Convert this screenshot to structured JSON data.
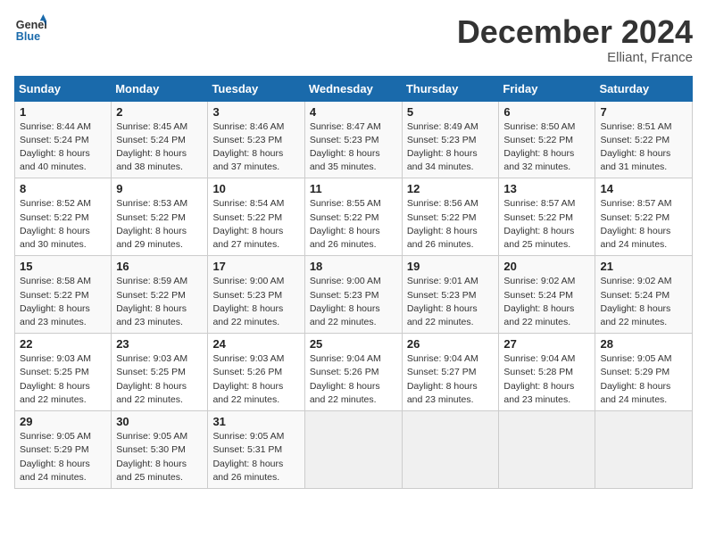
{
  "logo": {
    "line1": "General",
    "line2": "Blue"
  },
  "title": "December 2024",
  "location": "Elliant, France",
  "days_of_week": [
    "Sunday",
    "Monday",
    "Tuesday",
    "Wednesday",
    "Thursday",
    "Friday",
    "Saturday"
  ],
  "weeks": [
    [
      {
        "day": "1",
        "info": "Sunrise: 8:44 AM\nSunset: 5:24 PM\nDaylight: 8 hours and 40 minutes."
      },
      {
        "day": "2",
        "info": "Sunrise: 8:45 AM\nSunset: 5:24 PM\nDaylight: 8 hours and 38 minutes."
      },
      {
        "day": "3",
        "info": "Sunrise: 8:46 AM\nSunset: 5:23 PM\nDaylight: 8 hours and 37 minutes."
      },
      {
        "day": "4",
        "info": "Sunrise: 8:47 AM\nSunset: 5:23 PM\nDaylight: 8 hours and 35 minutes."
      },
      {
        "day": "5",
        "info": "Sunrise: 8:49 AM\nSunset: 5:23 PM\nDaylight: 8 hours and 34 minutes."
      },
      {
        "day": "6",
        "info": "Sunrise: 8:50 AM\nSunset: 5:22 PM\nDaylight: 8 hours and 32 minutes."
      },
      {
        "day": "7",
        "info": "Sunrise: 8:51 AM\nSunset: 5:22 PM\nDaylight: 8 hours and 31 minutes."
      }
    ],
    [
      {
        "day": "8",
        "info": "Sunrise: 8:52 AM\nSunset: 5:22 PM\nDaylight: 8 hours and 30 minutes."
      },
      {
        "day": "9",
        "info": "Sunrise: 8:53 AM\nSunset: 5:22 PM\nDaylight: 8 hours and 29 minutes."
      },
      {
        "day": "10",
        "info": "Sunrise: 8:54 AM\nSunset: 5:22 PM\nDaylight: 8 hours and 27 minutes."
      },
      {
        "day": "11",
        "info": "Sunrise: 8:55 AM\nSunset: 5:22 PM\nDaylight: 8 hours and 26 minutes."
      },
      {
        "day": "12",
        "info": "Sunrise: 8:56 AM\nSunset: 5:22 PM\nDaylight: 8 hours and 26 minutes."
      },
      {
        "day": "13",
        "info": "Sunrise: 8:57 AM\nSunset: 5:22 PM\nDaylight: 8 hours and 25 minutes."
      },
      {
        "day": "14",
        "info": "Sunrise: 8:57 AM\nSunset: 5:22 PM\nDaylight: 8 hours and 24 minutes."
      }
    ],
    [
      {
        "day": "15",
        "info": "Sunrise: 8:58 AM\nSunset: 5:22 PM\nDaylight: 8 hours and 23 minutes."
      },
      {
        "day": "16",
        "info": "Sunrise: 8:59 AM\nSunset: 5:22 PM\nDaylight: 8 hours and 23 minutes."
      },
      {
        "day": "17",
        "info": "Sunrise: 9:00 AM\nSunset: 5:23 PM\nDaylight: 8 hours and 22 minutes."
      },
      {
        "day": "18",
        "info": "Sunrise: 9:00 AM\nSunset: 5:23 PM\nDaylight: 8 hours and 22 minutes."
      },
      {
        "day": "19",
        "info": "Sunrise: 9:01 AM\nSunset: 5:23 PM\nDaylight: 8 hours and 22 minutes."
      },
      {
        "day": "20",
        "info": "Sunrise: 9:02 AM\nSunset: 5:24 PM\nDaylight: 8 hours and 22 minutes."
      },
      {
        "day": "21",
        "info": "Sunrise: 9:02 AM\nSunset: 5:24 PM\nDaylight: 8 hours and 22 minutes."
      }
    ],
    [
      {
        "day": "22",
        "info": "Sunrise: 9:03 AM\nSunset: 5:25 PM\nDaylight: 8 hours and 22 minutes."
      },
      {
        "day": "23",
        "info": "Sunrise: 9:03 AM\nSunset: 5:25 PM\nDaylight: 8 hours and 22 minutes."
      },
      {
        "day": "24",
        "info": "Sunrise: 9:03 AM\nSunset: 5:26 PM\nDaylight: 8 hours and 22 minutes."
      },
      {
        "day": "25",
        "info": "Sunrise: 9:04 AM\nSunset: 5:26 PM\nDaylight: 8 hours and 22 minutes."
      },
      {
        "day": "26",
        "info": "Sunrise: 9:04 AM\nSunset: 5:27 PM\nDaylight: 8 hours and 23 minutes."
      },
      {
        "day": "27",
        "info": "Sunrise: 9:04 AM\nSunset: 5:28 PM\nDaylight: 8 hours and 23 minutes."
      },
      {
        "day": "28",
        "info": "Sunrise: 9:05 AM\nSunset: 5:29 PM\nDaylight: 8 hours and 24 minutes."
      }
    ],
    [
      {
        "day": "29",
        "info": "Sunrise: 9:05 AM\nSunset: 5:29 PM\nDaylight: 8 hours and 24 minutes."
      },
      {
        "day": "30",
        "info": "Sunrise: 9:05 AM\nSunset: 5:30 PM\nDaylight: 8 hours and 25 minutes."
      },
      {
        "day": "31",
        "info": "Sunrise: 9:05 AM\nSunset: 5:31 PM\nDaylight: 8 hours and 26 minutes."
      },
      {
        "day": "",
        "info": ""
      },
      {
        "day": "",
        "info": ""
      },
      {
        "day": "",
        "info": ""
      },
      {
        "day": "",
        "info": ""
      }
    ]
  ]
}
